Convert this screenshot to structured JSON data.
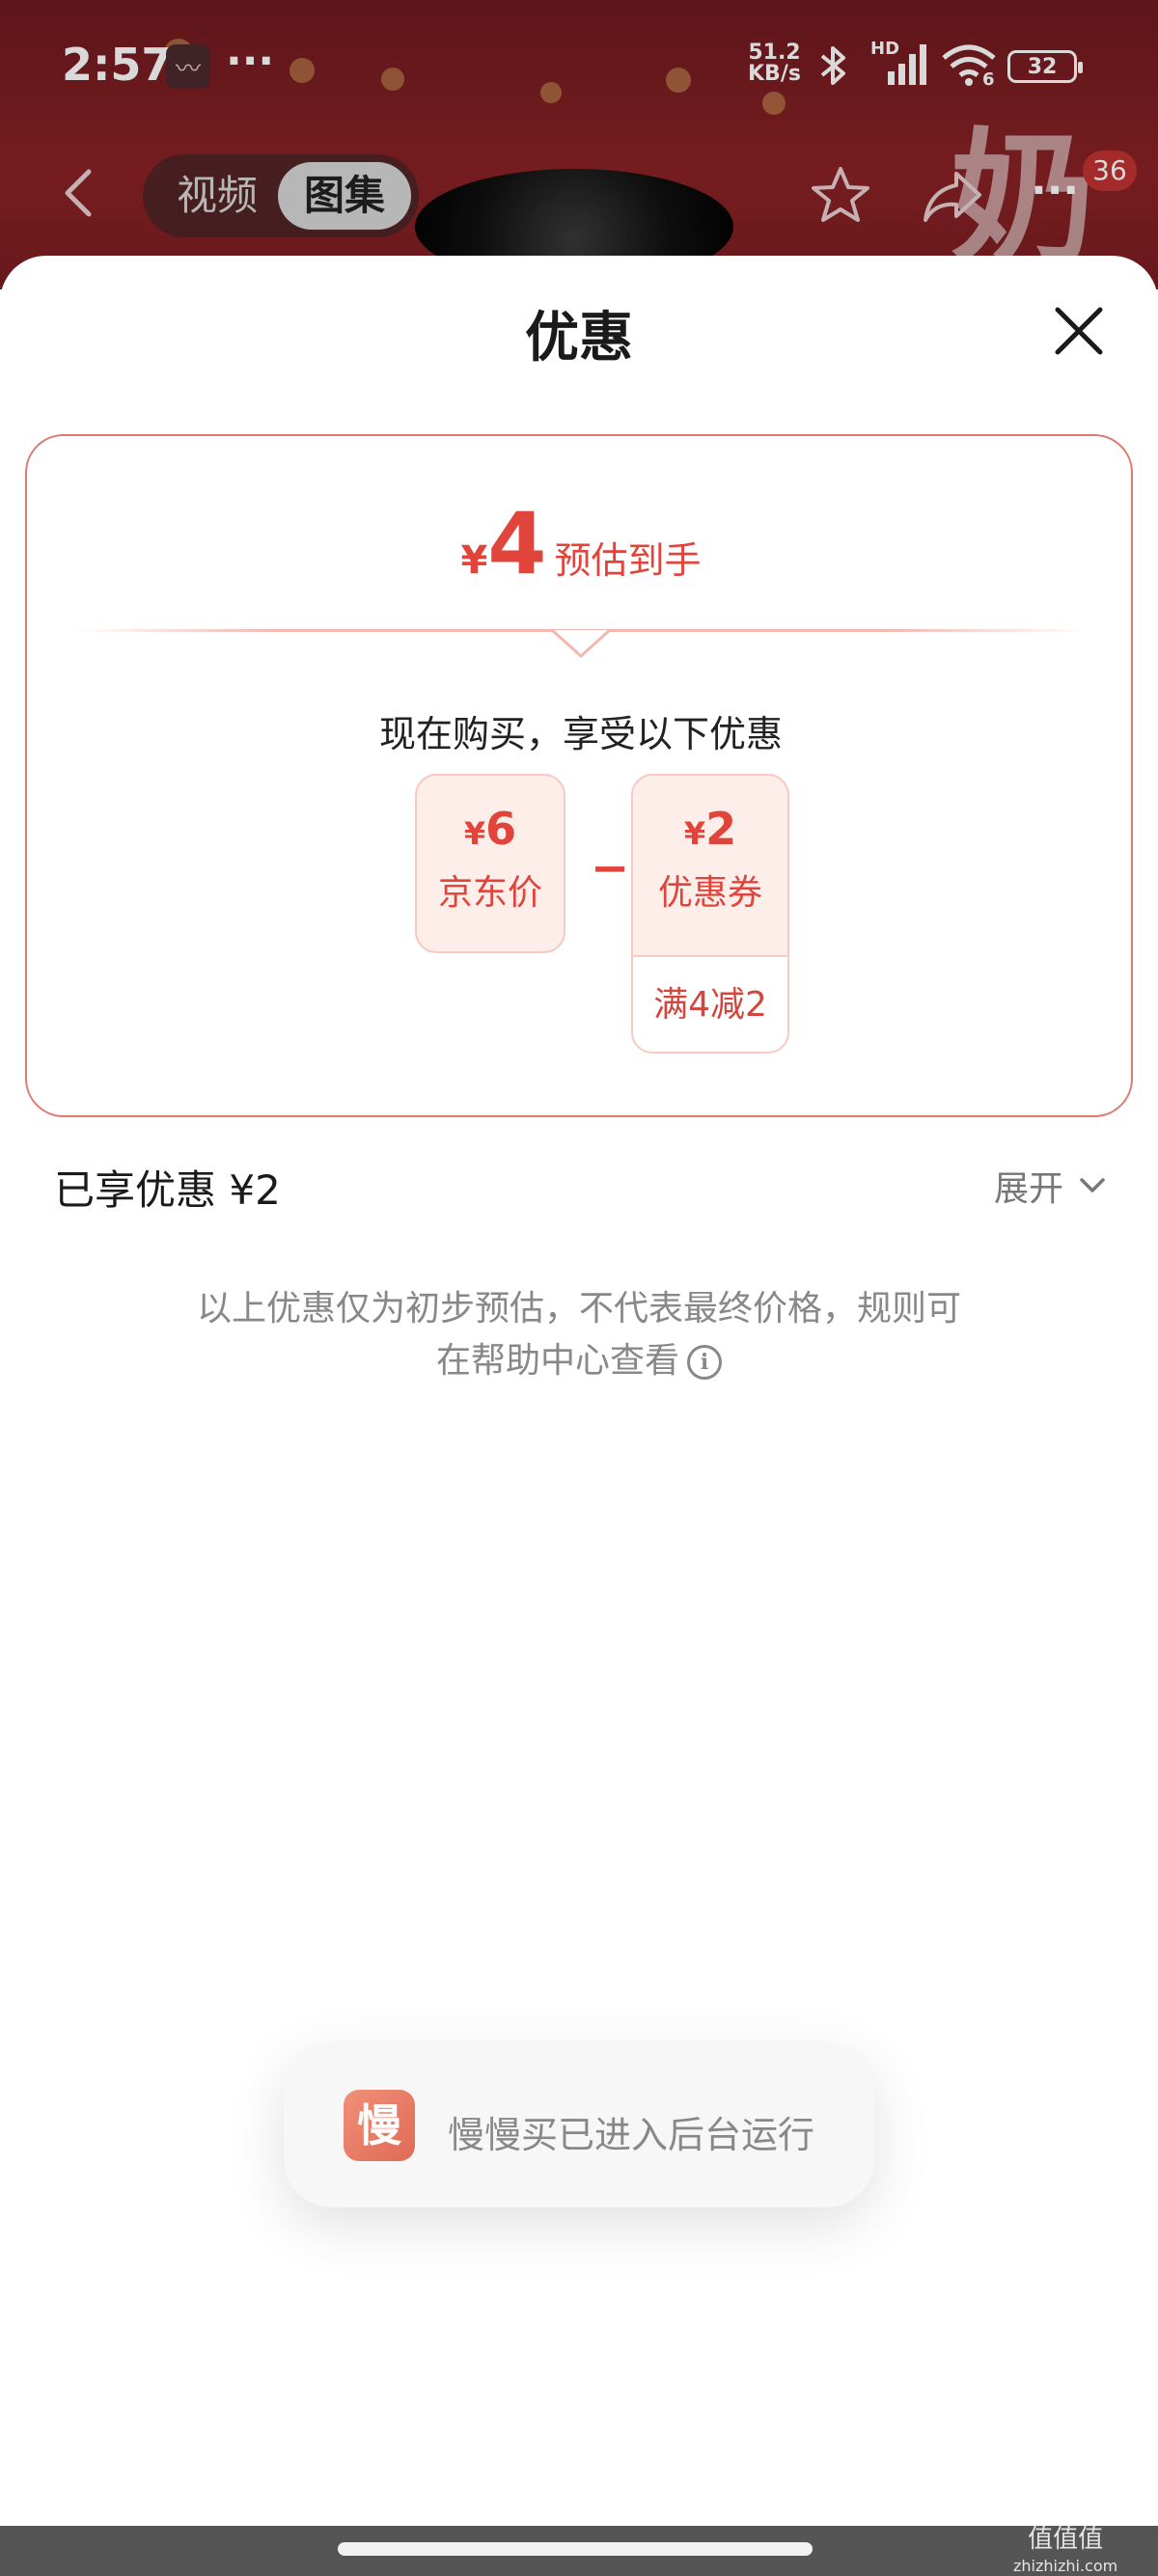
{
  "status_bar": {
    "time": "2:57",
    "app_icon": "〰",
    "dots": "···",
    "net_speed_value": "51.2",
    "net_speed_unit": "KB/s",
    "signal_label": "HD",
    "wifi_label": "6",
    "battery": "32"
  },
  "top_nav": {
    "tabs": [
      {
        "label": "视频",
        "active": false
      },
      {
        "label": "图集",
        "active": true
      }
    ],
    "badge": "36",
    "bg_char": "奶"
  },
  "sheet": {
    "title": "优惠",
    "estimate": {
      "currency": "¥",
      "amount": "4",
      "label": "预估到手"
    },
    "now_buy_text": "现在购买，享受以下优惠",
    "jd_price": {
      "currency": "¥",
      "value": "6",
      "label": "京东价"
    },
    "minus_sign": "−",
    "coupon": {
      "currency": "¥",
      "value": "2",
      "label": "优惠券",
      "condition": "满4减2"
    },
    "enjoyed": "已享优惠 ¥2",
    "expand_label": "展开",
    "disclaimer_line1": "以上优惠仅为初步预估，不代表最终价格，规则可",
    "disclaimer_line2": "在帮助中心查看",
    "info_icon": "i"
  },
  "toast": {
    "icon_char": "慢",
    "text": "慢慢买已进入后台运行"
  },
  "watermark": {
    "line1": "值值值",
    "line2": "zhizhizhi.com"
  },
  "colors": {
    "accent": "#e0443a",
    "card_border": "#e07a70",
    "box_bg": "#fdeeea"
  }
}
